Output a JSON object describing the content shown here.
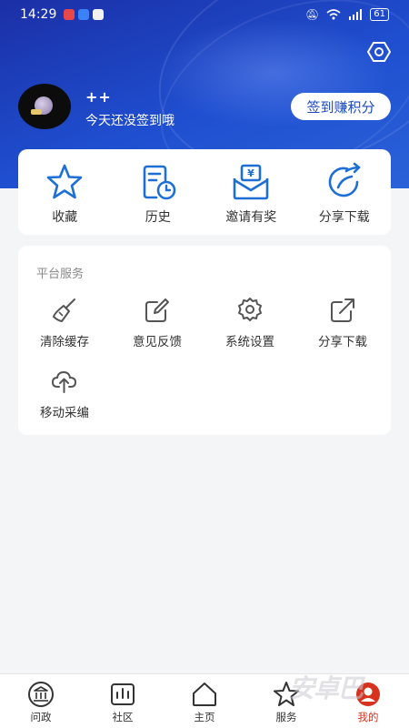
{
  "status_bar": {
    "time": "14:29",
    "battery": "61"
  },
  "user": {
    "name": "++",
    "subtitle": "今天还没签到哦",
    "checkin_label": "签到赚积分"
  },
  "quick_actions": [
    {
      "label": "收藏",
      "icon": "star-icon"
    },
    {
      "label": "历史",
      "icon": "history-icon"
    },
    {
      "label": "邀请有奖",
      "icon": "invite-reward-icon"
    },
    {
      "label": "分享下载",
      "icon": "share-icon"
    }
  ],
  "services": {
    "title": "平台服务",
    "items": [
      {
        "label": "清除缓存",
        "icon": "broom-icon"
      },
      {
        "label": "意见反馈",
        "icon": "feedback-edit-icon"
      },
      {
        "label": "系统设置",
        "icon": "gear-icon"
      },
      {
        "label": "分享下载",
        "icon": "share-icon"
      },
      {
        "label": "移动采编",
        "icon": "cloud-upload-icon"
      }
    ]
  },
  "tabs": [
    {
      "label": "问政",
      "icon": "politics-icon"
    },
    {
      "label": "社区",
      "icon": "community-icon"
    },
    {
      "label": "主页",
      "icon": "home-icon"
    },
    {
      "label": "服务",
      "icon": "star-outline-icon"
    },
    {
      "label": "我的",
      "icon": "profile-icon",
      "active": true
    }
  ],
  "colors": {
    "header_blue": "#1f4fd0",
    "accent_blue": "#1d6fd6",
    "active_red": "#d6321e"
  }
}
